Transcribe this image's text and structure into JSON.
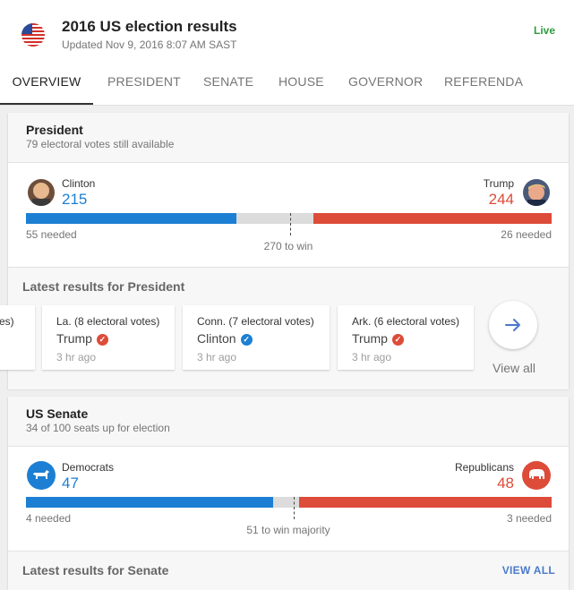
{
  "header": {
    "title": "2016 US election results",
    "updated": "Updated Nov 9, 2016 8:07 AM SAST",
    "live": "Live",
    "flag_icon": "us-flag-icon"
  },
  "tabs": [
    {
      "label": "OVERVIEW",
      "active": true
    },
    {
      "label": "PRESIDENT"
    },
    {
      "label": "SENATE"
    },
    {
      "label": "HOUSE"
    },
    {
      "label": "GOVERNOR"
    },
    {
      "label": "REFERENDA"
    }
  ],
  "colors": {
    "dem": "#1c7fd3",
    "rep": "#dd4b39",
    "neutral": "#dcdcdc",
    "live": "#2e9c3f"
  },
  "president": {
    "title": "President",
    "subtitle": "79 electoral votes still available",
    "dem": {
      "name": "Clinton",
      "votes": "215",
      "needed": "55 needed"
    },
    "rep": {
      "name": "Trump",
      "votes": "244",
      "needed": "26 needed"
    },
    "to_win": "270 to win",
    "bar": {
      "dem": 215,
      "rep": 244,
      "total": 538,
      "threshold": 270
    },
    "latest_title": "Latest results for President",
    "results": [
      {
        "state": "es)",
        "winner": "",
        "time": ""
      },
      {
        "state": "La. (8 electoral votes)",
        "winner": "Trump",
        "party": "rep",
        "time": "3 hr ago"
      },
      {
        "state": "Conn. (7 electoral votes)",
        "winner": "Clinton",
        "party": "dem",
        "time": "3 hr ago"
      },
      {
        "state": "Ark. (6 electoral votes)",
        "winner": "Trump",
        "party": "rep",
        "time": "3 hr ago"
      }
    ],
    "view_all": "View all"
  },
  "senate": {
    "title": "US Senate",
    "subtitle": "34 of 100 seats up for election",
    "dem": {
      "name": "Democrats",
      "seats": "47",
      "needed": "4 needed"
    },
    "rep": {
      "name": "Republicans",
      "seats": "48",
      "needed": "3 needed"
    },
    "to_win": "51 to win majority",
    "bar": {
      "dem": 47,
      "rep": 48,
      "total": 100,
      "threshold": 51
    },
    "latest_title": "Latest results for Senate",
    "view_all": "VIEW ALL"
  }
}
